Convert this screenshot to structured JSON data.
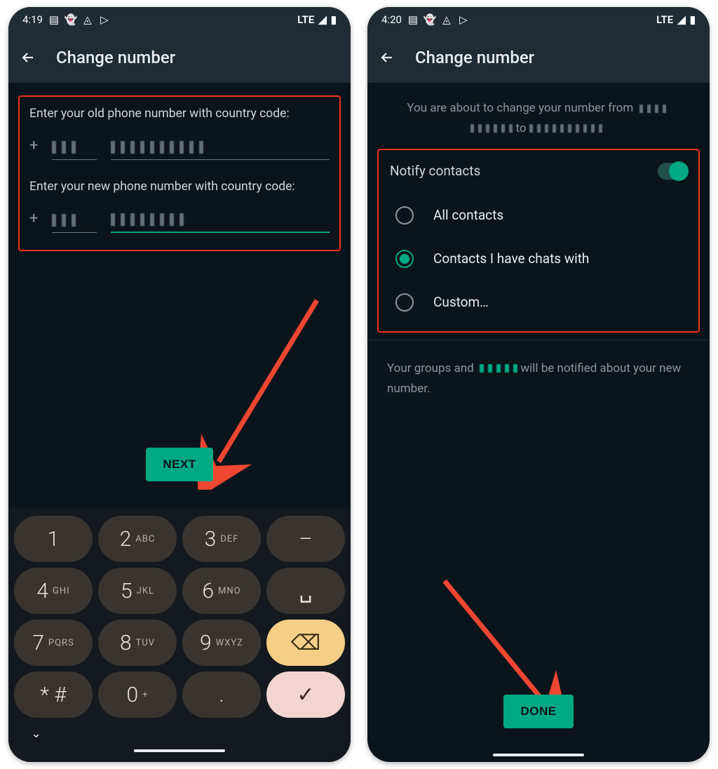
{
  "left": {
    "status": {
      "time": "4:19",
      "net": "LTE"
    },
    "appbar_title": "Change number",
    "old_label": "Enter your old phone number with country code:",
    "new_label": "Enter your new phone number with country code:",
    "next": "NEXT",
    "keypad": {
      "rows": [
        [
          {
            "d": "1",
            "l": ""
          },
          {
            "d": "2",
            "l": "ABC"
          },
          {
            "d": "3",
            "l": "DEF"
          },
          {
            "d": "–",
            "l": ""
          }
        ],
        [
          {
            "d": "4",
            "l": "GHI"
          },
          {
            "d": "5",
            "l": "JKL"
          },
          {
            "d": "6",
            "l": "MNO"
          },
          {
            "d": "␣",
            "l": ""
          }
        ],
        [
          {
            "d": "7",
            "l": "PQRS"
          },
          {
            "d": "8",
            "l": "TUV"
          },
          {
            "d": "9",
            "l": "WXYZ"
          },
          {
            "d": "⌫",
            "l": "",
            "cls": "bksp"
          }
        ],
        [
          {
            "d": "* #",
            "l": ""
          },
          {
            "d": "0",
            "l": "+"
          },
          {
            "d": ".",
            "l": ""
          },
          {
            "d": "✓",
            "l": "",
            "cls": "enter"
          }
        ]
      ]
    }
  },
  "right": {
    "status": {
      "time": "4:20",
      "net": "LTE"
    },
    "appbar_title": "Change number",
    "info_pre": "You are about to change your number from",
    "info_to": "to",
    "notify_title": "Notify contacts",
    "options": [
      {
        "label": "All contacts",
        "selected": false
      },
      {
        "label": "Contacts I have chats with",
        "selected": true
      },
      {
        "label": "Custom…",
        "selected": false
      }
    ],
    "groups_pre": "Your groups and",
    "groups_post": "will be notified about your new number.",
    "done": "DONE"
  }
}
